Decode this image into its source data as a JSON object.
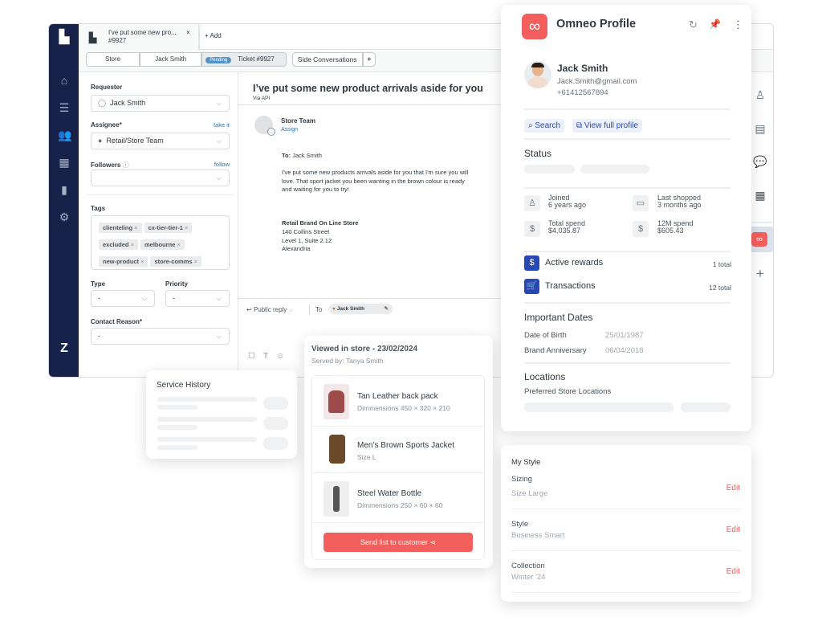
{
  "ticket_tab": {
    "title": "I've put some new pro...",
    "number": "#9927",
    "close": "×",
    "add": "+ Add"
  },
  "breadcrumbs": [
    {
      "label": "Store"
    },
    {
      "label": "Jack Smith"
    },
    {
      "label": "Ticket #9927",
      "badge": "Pending"
    }
  ],
  "side_conversations": {
    "label": "Side Conversations",
    "add": "+"
  },
  "left_panel": {
    "requester_label": "Requester",
    "requester_value": "Jack Smith",
    "assignee_label": "Assignee*",
    "assignee_link": "take it",
    "assignee_value": "Retail/Store Team",
    "followers_label": "Followers",
    "followers_link": "follow",
    "tags_label": "Tags",
    "tags": [
      "clienteling",
      "cx-tier-tier-1",
      "excluded",
      "melbourne",
      "new-product",
      "store-comms"
    ],
    "type_label": "Type",
    "type_value": "-",
    "priority_label": "Priority",
    "priority_value": "-",
    "contact_reason_label": "Contact Reason*",
    "contact_reason_value": "-"
  },
  "conversation": {
    "subject": "I’ve put some new product arrivals aside for you",
    "via": "Via API",
    "author": "Store Team",
    "assign_link": "Assign",
    "to_label": "To:",
    "to_value": "Jack Smith",
    "body": "I've put some new products arrivals aside for you that I'm sure you will love. That sport jacket you been wanting in the brown colour is ready and waiting for you to try!",
    "sig_name": "Retail Brand On Line Store",
    "sig_lines": [
      "140 Collins Street",
      "Level 1, Suite 2.12",
      "Alexandria"
    ],
    "reply_mode": "Public reply",
    "reply_to_label": "To",
    "reply_to_value": "Jack Smith"
  },
  "profile": {
    "app_title": "Omneo Profile",
    "name": "Jack Smith",
    "email": "Jack.Smith@gmail.com",
    "phone": "+61412567894",
    "search_label": "Search",
    "view_profile_label": "View full profile",
    "status_label": "Status",
    "stats": [
      {
        "label": "Joined",
        "value": "6 years ago",
        "icon": "user-plus-icon"
      },
      {
        "label": "Last shopped",
        "value": "3 months ago",
        "icon": "card-icon"
      },
      {
        "label": "Total spend",
        "value": "$4,035.87",
        "icon": "dollar-icon"
      },
      {
        "label": "12M spend",
        "value": "$605.43",
        "icon": "dollar-icon"
      }
    ],
    "rewards_label": "Active rewards",
    "rewards_count": "1 total",
    "transactions_label": "Transactions",
    "transactions_count": "12 total",
    "dates_label": "Important Dates",
    "dob_label": "Date of Birth",
    "dob_value": "25/01/1987",
    "anniv_label": "Brand Anniversary",
    "anniv_value": "06/04/2018",
    "locations_label": "Locations",
    "locations_sub": "Preferred Store Locations"
  },
  "service_history": {
    "title": "Service History"
  },
  "viewed": {
    "title": "Viewed in store - 23/02/2024",
    "served_by": "Served by: Tanya Smith",
    "products": [
      {
        "name": "Tan Leather back pack",
        "detail": "Dimmensions 450 × 320 × 210"
      },
      {
        "name": "Men’s Brown Sports Jacket",
        "detail": "Size L"
      },
      {
        "name": "Steel Water Bottle",
        "detail": "Dimmensions 250 × 60 × 60"
      }
    ],
    "send_button": "Send list to customer"
  },
  "my_style": {
    "title": "My Style",
    "items": [
      {
        "label": "Sizing",
        "value": "Size Large",
        "action": "Edit"
      },
      {
        "label": "Style",
        "value": "Business Smart",
        "action": "Edit"
      },
      {
        "label": "Collection",
        "value": "Winter '24",
        "action": "Edit"
      }
    ]
  },
  "colors": {
    "brand_red": "#f25f5c",
    "nav_dark": "#17224a",
    "accent_blue": "#2849b5"
  }
}
